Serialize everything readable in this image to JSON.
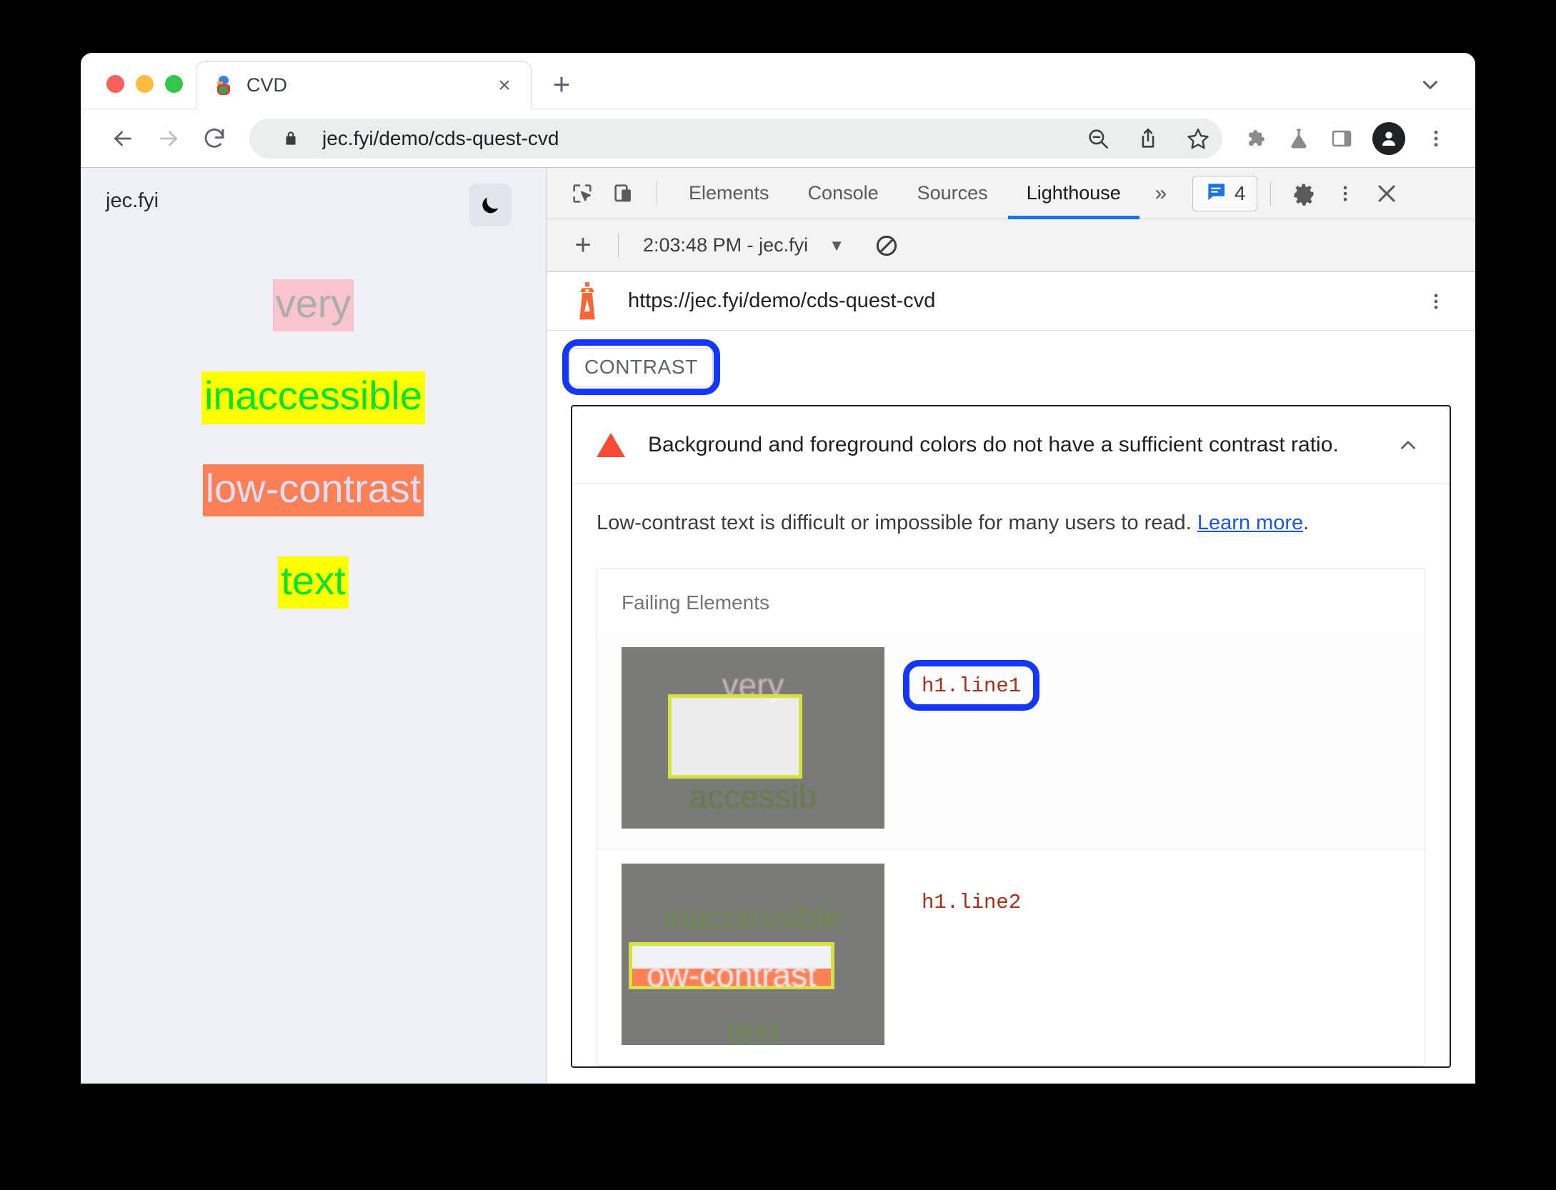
{
  "browser": {
    "tab": {
      "title": "CVD",
      "favicon": "parrot-favicon",
      "close": "×"
    },
    "new_tab": "+",
    "tab_strip_chevron": "chevron-down-icon",
    "omnibox": {
      "url": "jec.fyi/demo/cds-quest-cvd",
      "lock_icon": "lock-icon",
      "zoom_icon": "zoom-out-icon",
      "share_icon": "share-icon",
      "bookmark_icon": "star-icon"
    },
    "toolbar_icons": [
      "extensions-puzzle-icon",
      "labs-flask-icon",
      "side-panel-icon",
      "avatar-icon",
      "chrome-menu-kebab-icon"
    ],
    "nav": {
      "back": "back-arrow-icon",
      "forward": "forward-arrow-icon",
      "reload": "reload-icon"
    }
  },
  "page": {
    "brand": "jec.fyi",
    "dark_mode_toggle": "moon-icon",
    "lines": [
      {
        "text": "very",
        "fg": "#adadad",
        "bg": "#f8c4ce"
      },
      {
        "text": "inaccessible",
        "fg": "#00e234",
        "bg": "#ffff00"
      },
      {
        "text": "low-contrast",
        "fg": "#dcdcf2",
        "bg": "#fb8055"
      },
      {
        "text": "text",
        "fg": "#00e234",
        "bg": "#ffff00"
      }
    ]
  },
  "devtools": {
    "inspect_icon": "inspect-element-icon",
    "device_icon": "device-toolbar-icon",
    "tabs": [
      {
        "label": "Elements",
        "active": false
      },
      {
        "label": "Console",
        "active": false
      },
      {
        "label": "Sources",
        "active": false
      },
      {
        "label": "Lighthouse",
        "active": true
      }
    ],
    "overflow": "»",
    "issues": {
      "icon": "issues-message-icon",
      "count": "4"
    },
    "settings_icon": "gear-icon",
    "more_icon": "kebab-icon",
    "close_icon": "close-icon",
    "lighthouse_toolbar": {
      "add": "+",
      "run_label": "2:03:48 PM - jec.fyi",
      "caret": "▼",
      "clear_icon": "clear-blocked-icon"
    }
  },
  "report": {
    "lighthouse_icon": "lighthouse-icon",
    "url": "https://jec.fyi/demo/cds-quest-cvd",
    "kebab": "kebab-icon",
    "category_chip": "CONTRAST",
    "audit": {
      "warn_icon": "warning-triangle-icon",
      "title": "Background and foreground colors do not have a sufficient contrast ratio.",
      "collapse_icon": "chevron-up-icon",
      "description_before": "Low-contrast text is difficult or impossible for many users to read. ",
      "description_link": "Learn more",
      "description_after": "."
    },
    "failing_elements": {
      "title": "Failing Elements",
      "rows": [
        {
          "selector": "h1.line1",
          "highlighted": true,
          "thumb": {
            "above_text": "very",
            "above_color": "#cfb8bc",
            "inside_text": "",
            "below_text": "accessib",
            "below_color": "#6a7a4a"
          }
        },
        {
          "selector": "h1.line2",
          "highlighted": false,
          "thumb": {
            "above_text": "inaccessible",
            "above_color": "#6f8a4e",
            "inside_text": "ow-contrast",
            "below_text": "text",
            "below_color": "#6f8a4e"
          }
        }
      ]
    }
  },
  "annotation_color": "#1437ff"
}
